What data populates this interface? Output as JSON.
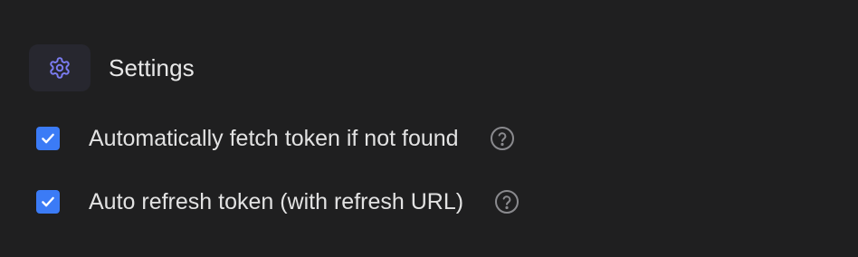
{
  "settings": {
    "title": "Settings",
    "icon": "gear-icon",
    "accent_color": "#7b7cf2",
    "options": [
      {
        "label": "Automatically fetch token if not found",
        "checked": true,
        "help_icon": "question-mark-icon"
      },
      {
        "label": "Auto refresh token (with refresh URL)",
        "checked": true,
        "help_icon": "question-mark-icon"
      }
    ]
  },
  "colors": {
    "background": "#1f1f20",
    "checkbox": "#3b7bf6",
    "text": "#e2e2e2",
    "help_icon": "#8a8a8e"
  }
}
